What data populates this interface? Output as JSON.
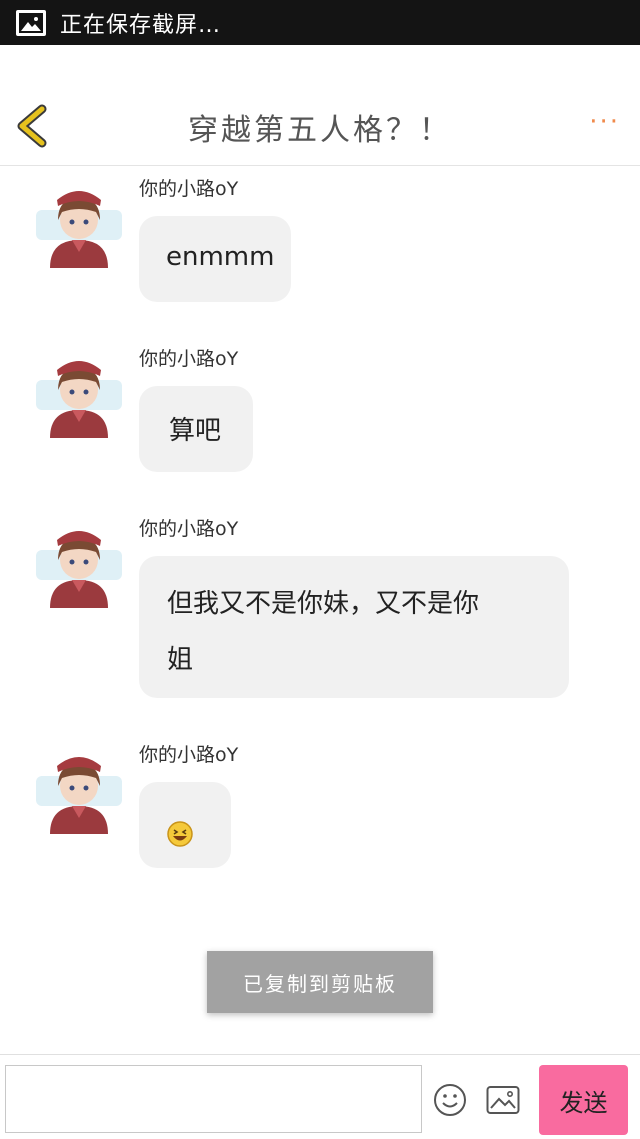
{
  "status_bar": {
    "text": "正在保存截屏…"
  },
  "header": {
    "title": "穿越第五人格？！",
    "more_label": "···"
  },
  "messages": [
    {
      "sender": "你的小路oY",
      "text": "enmmm"
    },
    {
      "sender": "你的小路oY",
      "text": "算吧"
    },
    {
      "sender": "你的小路oY",
      "lines": [
        "但我又不是你妹，又不是你",
        "姐"
      ]
    },
    {
      "sender": "你的小路oY",
      "emoji": "laughing-emoji"
    }
  ],
  "toast": {
    "text": "已复制到剪贴板"
  },
  "input_bar": {
    "placeholder": "",
    "send_label": "发送"
  },
  "colors": {
    "status_bar_bg": "#141414",
    "back_icon": "#e6c21e",
    "more_icon": "#f08a4b",
    "bubble_bg": "#f1f1f1",
    "send_button": "#f96b9f",
    "toast_bg": "#a2a2a2"
  }
}
